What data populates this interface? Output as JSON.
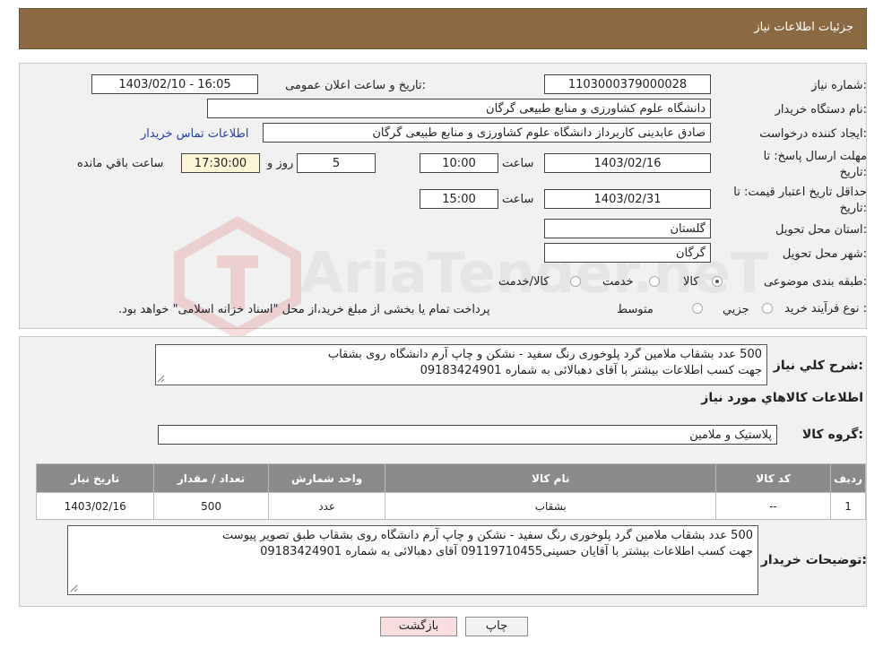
{
  "header": {
    "title": "جزئیات اطلاعات نیاز"
  },
  "form": {
    "need_number_label": "شماره نیاز:",
    "need_number": "1103000379000028",
    "announce_label": "تاریخ و ساعت اعلان عمومی:",
    "announce_value": "1403/02/10 - 16:05",
    "buyer_org_label": "نام دستگاه خریدار:",
    "buyer_org": "دانشگاه علوم کشاورزی و منابع طبیعی گرگان",
    "creator_label": "ایجاد کننده درخواست:",
    "creator": "صادق عابدینی کاربرداز دانشگاه علوم کشاورزی و منابع طبیعی گرگان",
    "contact_link": "اطلاعات تماس خریدار",
    "reply_deadline_label_1": "مهلت ارسال پاسخ: تا",
    "reply_deadline_label_2": "تاریخ:",
    "reply_date": "1403/02/16",
    "time_label": "ساعت",
    "reply_time": "10:00",
    "days": "5",
    "days_label": "روز و",
    "remaining_time": "17:30:00",
    "remaining_label": "ساعت باقي مانده",
    "validity_label_1": "حداقل تاریخ اعتبار قیمت: تا",
    "validity_label_2": "تاریخ:",
    "validity_date": "1403/02/31",
    "validity_time": "15:00",
    "province_label": "استان محل تحویل:",
    "province": "گلستان",
    "city_label": "شهر محل تحویل:",
    "city": "گرگان",
    "category_label": "طبقه بندی موضوعی:",
    "category_options": [
      "کالا",
      "خدمت",
      "کالا/خدمت"
    ],
    "process_label": "نوع فرآیند خرید :",
    "process_options": [
      "جزيي",
      "متوسط"
    ],
    "process_note": "پرداخت تمام یا بخشی از مبلغ خرید،از محل \"اسناد خزانه اسلامی\" خواهد بود."
  },
  "description": {
    "label": "شرح کلي نياز:",
    "line1": "500 عدد بشقاب ملامین گرد پلوخوری رنگ سفید - نشکن و چاپ آرم دانشگاه روی بشقاب",
    "line2": "جهت کسب اطلاعات بیشتر با آقای دهبالائی به شماره 09183424901"
  },
  "goods": {
    "section_title": "اطلاعات کالاهاي مورد نياز",
    "group_label": "گروه کالا:",
    "group_value": "پلاستیک و ملامین",
    "columns": [
      "رديف",
      "کد کالا",
      "نام کالا",
      "واحد شمارش",
      "تعداد / مقدار",
      "تاريخ نياز"
    ],
    "rows": [
      [
        "1",
        "--",
        "بشقاب",
        "عدد",
        "500",
        "1403/02/16"
      ]
    ]
  },
  "buyer_notes": {
    "label": "توضیحات خریدار:",
    "line1": "500 عدد بشقاب ملامین گرد پلوخوری رنگ سفید - نشکن و چاپ آرم دانشگاه روی بشقاب طبق تصویر پیوست",
    "line2": "جهت کسب اطلاعات بیشتر با آقایان حسینی09119710455  آقای دهبالائی به شماره 09183424901"
  },
  "buttons": {
    "print": "چاپ",
    "back": "بازگشت"
  },
  "watermark": {
    "text": "AriaTender.neT"
  },
  "colors": {
    "header_bg": "#8b6a43",
    "panel_bg": "#f1f1f1",
    "table_header": "#8a8a8a",
    "link": "#1f3fae",
    "back_button_bg": "#f8dede"
  }
}
